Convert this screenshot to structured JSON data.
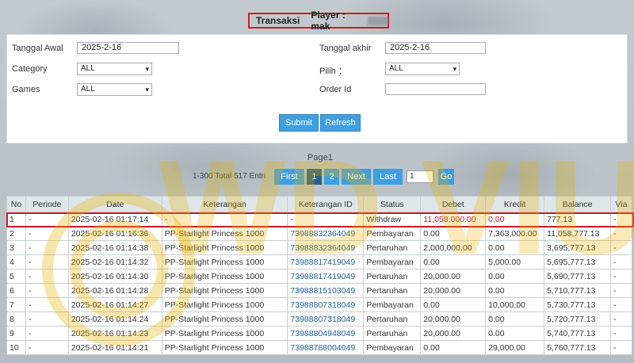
{
  "header": {
    "title": "Transaksi",
    "player_label": "Player : mak"
  },
  "filters": {
    "start_date_label": "Tanggal Awal",
    "start_date_value": "2025-2-16",
    "end_date_label": "Tanggal akhir",
    "end_date_value": "2025-2-16",
    "category_label": "Category",
    "category_value": "ALL",
    "pilih_label": "Pilih ：",
    "pilih_value": "ALL",
    "games_label": "Games",
    "games_value": "ALL",
    "order_label": "Order Id",
    "order_value": "",
    "submit_label": "Submit",
    "refresh_label": "Refresh"
  },
  "pagination": {
    "page_title": "Page1",
    "total_text": "1-300 Total 517 Entri",
    "first": "First",
    "page1": "1",
    "page2": "2",
    "next": "Next",
    "last": "Last",
    "goto_value": "1",
    "go": "Go"
  },
  "table": {
    "headers": [
      "No",
      "Periode",
      "Date",
      "Keterangan",
      "Keterangan ID",
      "Status",
      "Debet",
      "Kredit",
      "Balance",
      "Via"
    ],
    "rows": [
      [
        "1",
        "-",
        "2025-02-16 01:17:14",
        "-",
        "-",
        "Withdraw",
        "11,058,000.00",
        "0.00",
        "777.13",
        "-"
      ],
      [
        "2",
        "-",
        "2025-02-16 01:16:36",
        "PP-Starlight Princess 1000",
        "73988832364049",
        "Pembayaran",
        "0.00",
        "7,363,000.00",
        "11,058,777.13",
        "-"
      ],
      [
        "3",
        "-",
        "2025-02-16 01:14:38",
        "PP-Starlight Princess 1000",
        "73988832364049",
        "Pertaruhan",
        "2,000,000.00",
        "0.00",
        "3,695,777.13",
        "-"
      ],
      [
        "4",
        "-",
        "2025-02-16 01:14:32",
        "PP-Starlight Princess 1000",
        "73988817419049",
        "Pembayaran",
        "0.00",
        "5,000.00",
        "5,695,777.13",
        "-"
      ],
      [
        "5",
        "-",
        "2025-02-16 01:14:30",
        "PP-Starlight Princess 1000",
        "73988817419049",
        "Pertaruhan",
        "20,000.00",
        "0.00",
        "5,690,777.13",
        "-"
      ],
      [
        "6",
        "-",
        "2025-02-16 01:14:28",
        "PP-Starlight Princess 1000",
        "73988815103049",
        "Pertaruhan",
        "20,000.00",
        "0.00",
        "5,710,777.13",
        "-"
      ],
      [
        "7",
        "-",
        "2025-02-16 01:14:27",
        "PP-Starlight Princess 1000",
        "73988807318049",
        "Pembayaran",
        "0.00",
        "10,000.00",
        "5,730,777.13",
        "-"
      ],
      [
        "8",
        "-",
        "2025-02-16 01:14:24",
        "PP-Starlight Princess 1000",
        "73988807318049",
        "Pertaruhan",
        "20,000.00",
        "0.00",
        "5,720,777.13",
        "-"
      ],
      [
        "9",
        "-",
        "2025-02-16 01:14:23",
        "PP-Starlight Princess 1000",
        "73988804948049",
        "Pertaruhan",
        "20,000.00",
        "0.00",
        "5,740,777.13",
        "-"
      ],
      [
        "10",
        "-",
        "2025-02-16 01:14:21",
        "PP-Starlight Princess 1000",
        "73988788004049",
        "Pembayaran",
        "0.00",
        "29,000.00",
        "5,760,777.13",
        "-"
      ]
    ]
  },
  "watermark": {
    "text": "WD VIUK",
    "color": "#e8b400"
  },
  "colors": {
    "accent": "#3f9fe0",
    "active_page": "#2b5f86",
    "highlight": "#d0192a"
  }
}
